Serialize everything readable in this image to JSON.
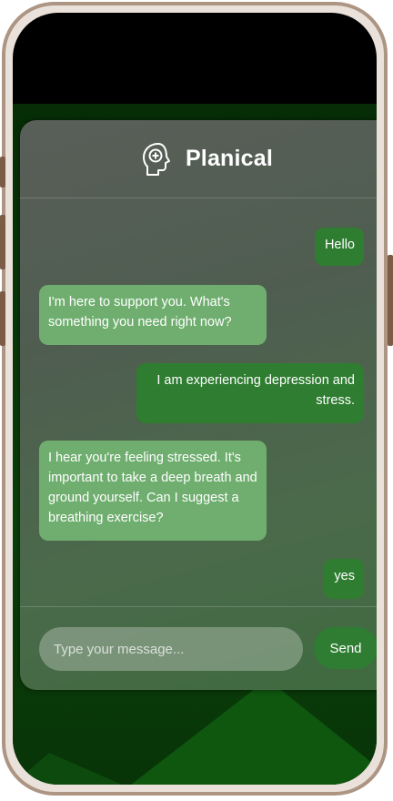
{
  "app": {
    "title": "Planical",
    "logo_icon": "head-plus-icon"
  },
  "messages": [
    {
      "role": "user",
      "text": "Hello"
    },
    {
      "role": "bot",
      "text": "I'm here to support you. What's something you need right now?"
    },
    {
      "role": "user",
      "text": "I am experiencing depression and stress."
    },
    {
      "role": "bot",
      "text": "I hear you're feeling stressed. It's important to take a deep breath and ground yourself. Can I suggest a breathing exercise?"
    },
    {
      "role": "user",
      "text": "yes"
    }
  ],
  "composer": {
    "placeholder": "Type your message...",
    "value": "",
    "send_label": "Send"
  },
  "colors": {
    "user_bubble": "#2f7d31",
    "bot_bubble": "#6fae6f",
    "send_button": "#2e7d32",
    "frame": "#ad9584"
  }
}
